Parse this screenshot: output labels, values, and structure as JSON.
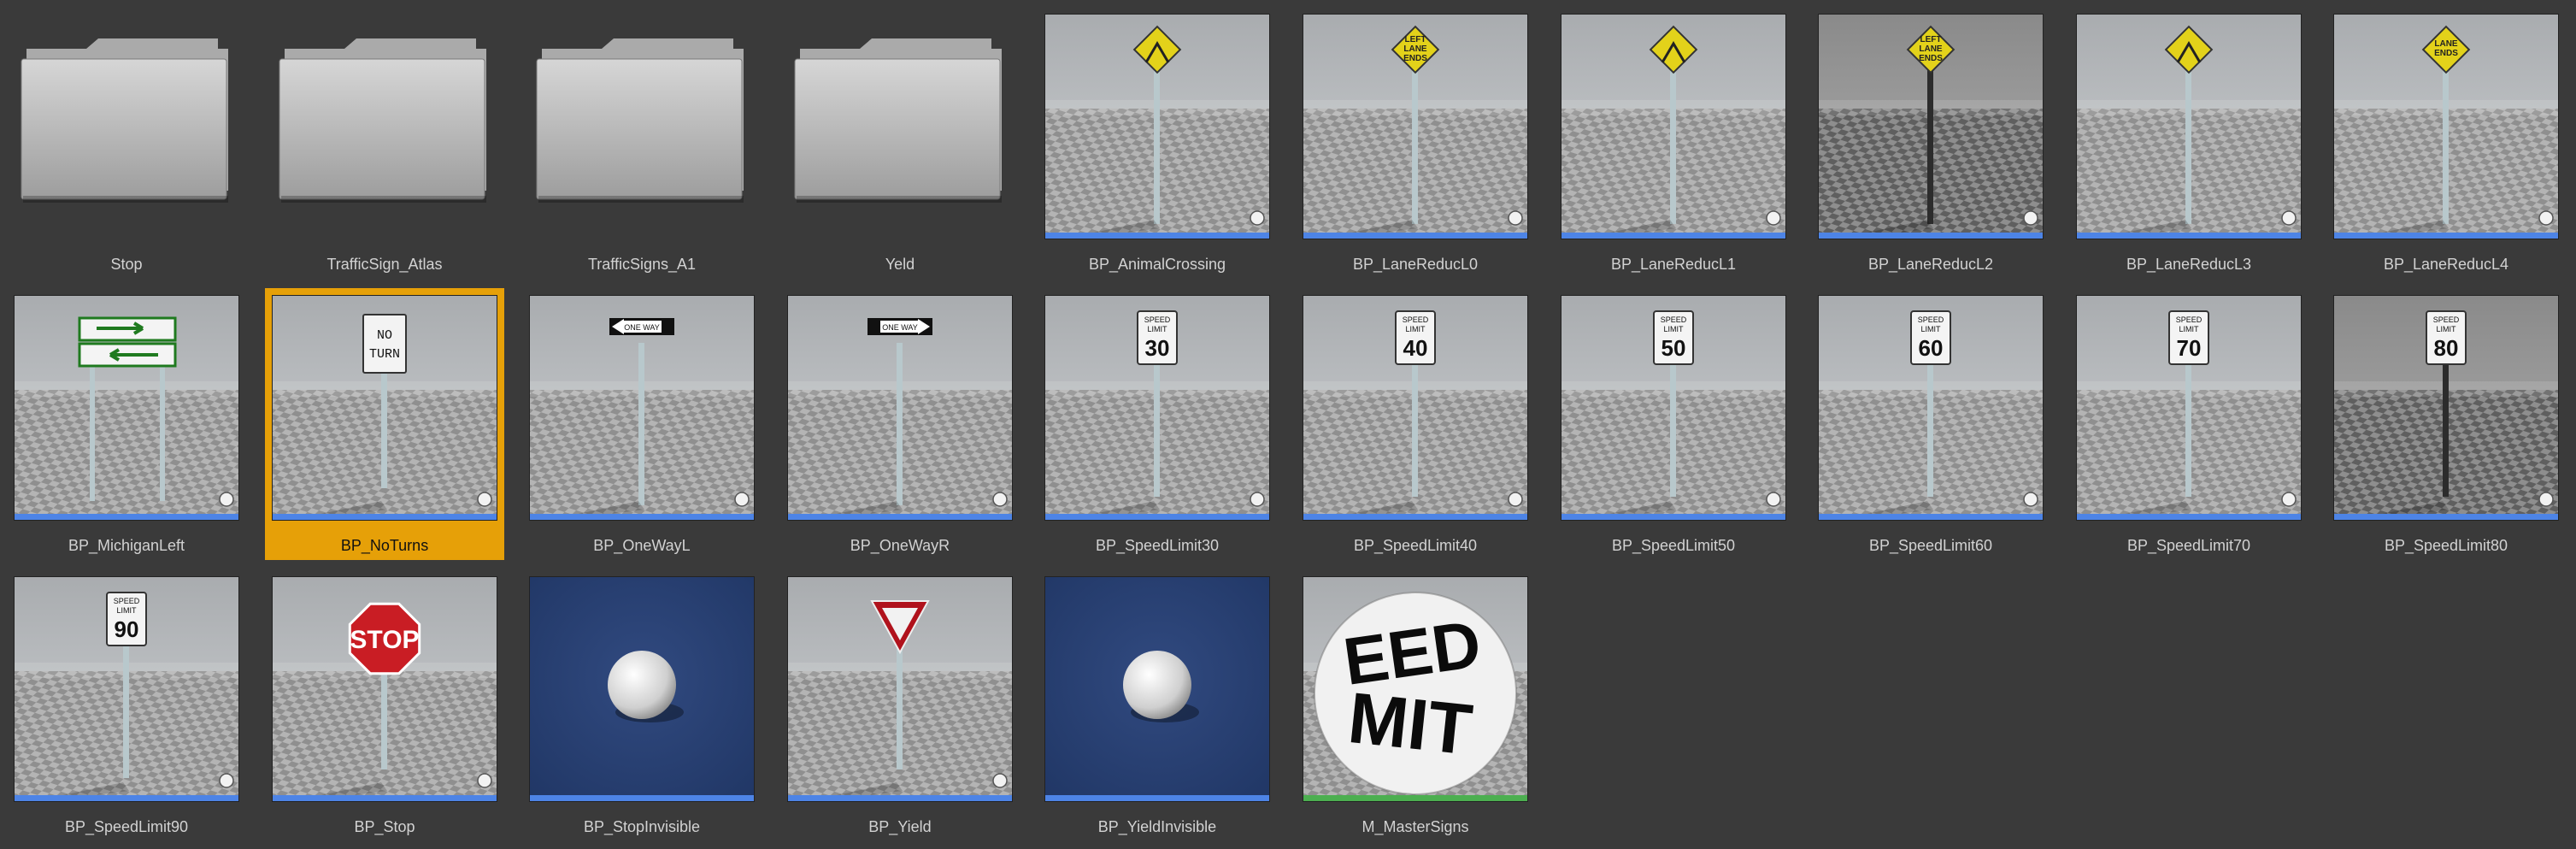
{
  "colors": {
    "background": "#3a3a3a",
    "label_text": "#d2d2d2",
    "selection": "#e6a008",
    "blueprint_strip": "#4d84e6",
    "material_strip": "#4caf50",
    "folder": "#b8b8b8"
  },
  "assets": [
    {
      "name": "Stop",
      "type": "folder"
    },
    {
      "name": "TrafficSign_Atlas",
      "type": "folder"
    },
    {
      "name": "TrafficSigns_A1",
      "type": "folder"
    },
    {
      "name": "Yeld",
      "type": "folder"
    },
    {
      "name": "BP_AnimalCrossing",
      "type": "blueprint",
      "sign": "diamond",
      "sign_text": ""
    },
    {
      "name": "BP_LaneReducL0",
      "type": "blueprint",
      "sign": "diamond",
      "sign_text": "LEFT LANE ENDS"
    },
    {
      "name": "BP_LaneReducL1",
      "type": "blueprint",
      "sign": "diamond",
      "sign_text": ""
    },
    {
      "name": "BP_LaneReducL2",
      "type": "blueprint",
      "sign": "diamond",
      "sign_text": "LEFT LANE ENDS",
      "dark": true
    },
    {
      "name": "BP_LaneReducL3",
      "type": "blueprint",
      "sign": "diamond",
      "sign_text": ""
    },
    {
      "name": "BP_LaneReducL4",
      "type": "blueprint",
      "sign": "diamond",
      "sign_text": "LANE ENDS"
    },
    {
      "name": "BP_MichiganLeft",
      "type": "blueprint",
      "sign": "green",
      "sign_text": ""
    },
    {
      "name": "BP_NoTurns",
      "type": "blueprint",
      "sign": "rect",
      "sign_text": "NO TURN",
      "selected": true
    },
    {
      "name": "BP_OneWayL",
      "type": "blueprint",
      "sign": "oneway_left",
      "sign_text": "ONE WAY"
    },
    {
      "name": "BP_OneWayR",
      "type": "blueprint",
      "sign": "oneway_right",
      "sign_text": "ONE WAY"
    },
    {
      "name": "BP_SpeedLimit30",
      "type": "blueprint",
      "sign": "speed",
      "sign_text": "SPEED LIMIT",
      "speed": "30"
    },
    {
      "name": "BP_SpeedLimit40",
      "type": "blueprint",
      "sign": "speed",
      "sign_text": "SPEED LIMIT",
      "speed": "40"
    },
    {
      "name": "BP_SpeedLimit50",
      "type": "blueprint",
      "sign": "speed",
      "sign_text": "SPEED LIMIT",
      "speed": "50"
    },
    {
      "name": "BP_SpeedLimit60",
      "type": "blueprint",
      "sign": "speed",
      "sign_text": "SPEED LIMIT",
      "speed": "60"
    },
    {
      "name": "BP_SpeedLimit70",
      "type": "blueprint",
      "sign": "speed",
      "sign_text": "SPEED LIMIT",
      "speed": "70"
    },
    {
      "name": "BP_SpeedLimit80",
      "type": "blueprint",
      "sign": "speed",
      "sign_text": "SPEED LIMIT",
      "speed": "80",
      "dark": true
    },
    {
      "name": "BP_SpeedLimit90",
      "type": "blueprint",
      "sign": "speed",
      "sign_text": "SPEED LIMIT",
      "speed": "90"
    },
    {
      "name": "BP_Stop",
      "type": "blueprint",
      "sign": "stop",
      "sign_text": "STOP"
    },
    {
      "name": "BP_StopInvisible",
      "type": "blueprint",
      "sign": "sphere"
    },
    {
      "name": "BP_Yield",
      "type": "blueprint",
      "sign": "yield",
      "sign_text": ""
    },
    {
      "name": "BP_YieldInvisible",
      "type": "blueprint",
      "sign": "sphere"
    },
    {
      "name": "M_MasterSigns",
      "type": "material",
      "sign": "ball",
      "sign_text": "EED MIT"
    }
  ]
}
